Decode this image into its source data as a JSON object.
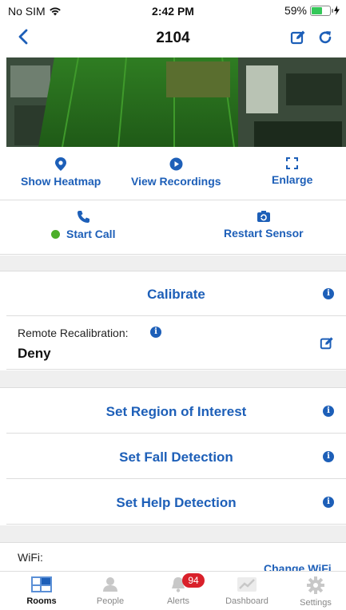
{
  "status_bar": {
    "carrier": "No SIM",
    "time": "2:42 PM",
    "battery": "59%",
    "battery_level": 0.59
  },
  "nav": {
    "title": "2104"
  },
  "actions": {
    "show_heatmap": "Show Heatmap",
    "view_recordings": "View Recordings",
    "enlarge": "Enlarge",
    "start_call": "Start Call",
    "restart_sensor": "Restart Sensor"
  },
  "calibrate": {
    "label": "Calibrate"
  },
  "remote_recalibration": {
    "label": "Remote Recalibration:",
    "value": "Deny"
  },
  "detection": {
    "region_of_interest": "Set Region of Interest",
    "fall_detection": "Set Fall Detection",
    "help_detection": "Set Help Detection"
  },
  "wifi": {
    "label": "WiFi:",
    "change": "Change WiFi"
  },
  "tabs": [
    {
      "label": "Rooms",
      "icon": "rooms-icon",
      "active": true
    },
    {
      "label": "People",
      "icon": "people-icon"
    },
    {
      "label": "Alerts",
      "icon": "bell-icon",
      "badge": "94"
    },
    {
      "label": "Dashboard",
      "icon": "chart-icon"
    },
    {
      "label": "Settings",
      "icon": "gear-icon"
    }
  ],
  "colors": {
    "accent": "#1d5fb8",
    "status_green": "#4cae2a",
    "badge_red": "#d9202a"
  }
}
